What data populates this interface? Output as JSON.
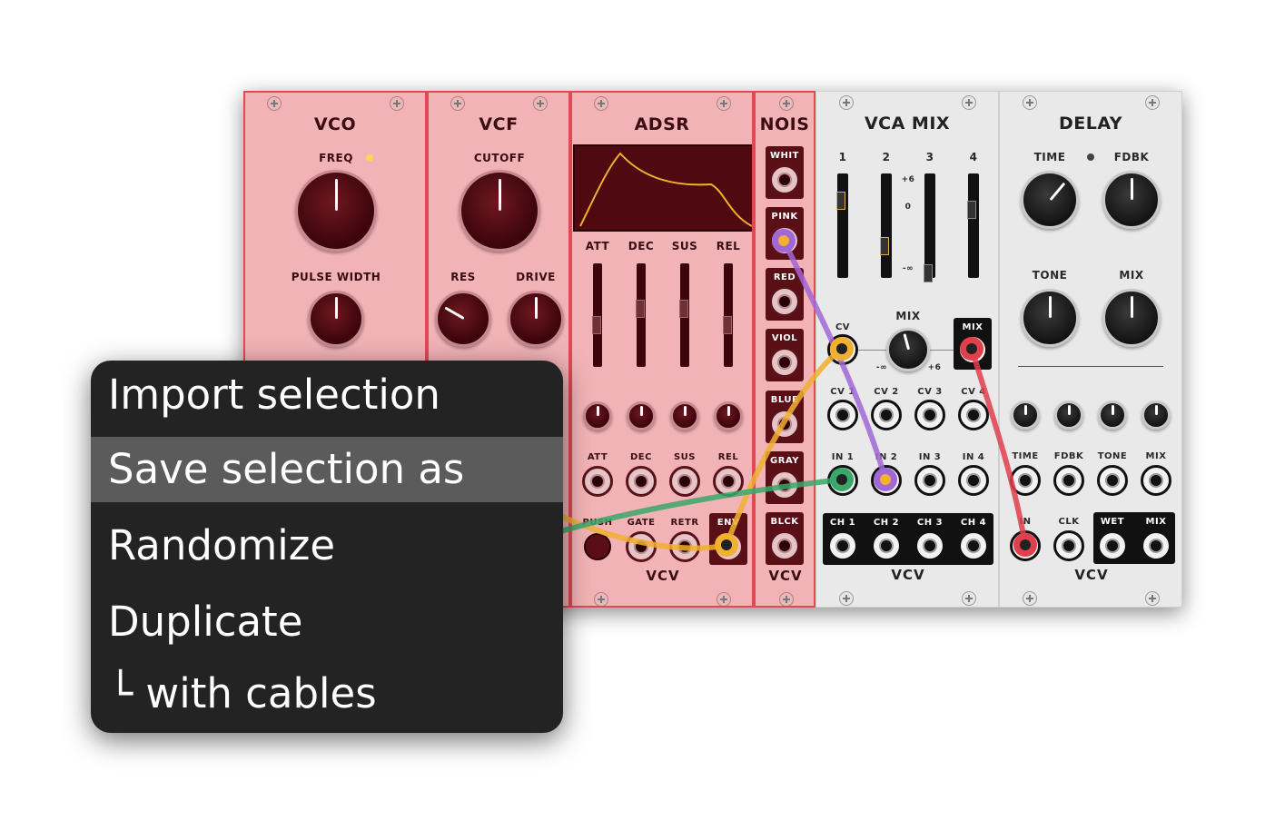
{
  "menu": {
    "items": [
      {
        "label": "Import selection",
        "highlighted": false
      },
      {
        "label": "Save selection as",
        "highlighted": true
      },
      {
        "label": "Randomize",
        "highlighted": false
      },
      {
        "label": "Duplicate",
        "highlighted": false
      },
      {
        "label": "└ with cables",
        "highlighted": false
      }
    ]
  },
  "modules": {
    "vco": {
      "title": "VCO",
      "freq": "FREQ",
      "pulse_width": "PULSE WIDTH"
    },
    "vcf": {
      "title": "VCF",
      "cutoff": "CUTOFF",
      "res": "RES",
      "drive": "DRIVE"
    },
    "adsr": {
      "title": "ADSR",
      "sliders": [
        "ATT",
        "DEC",
        "SUS",
        "REL"
      ],
      "cv": [
        "ATT",
        "DEC",
        "SUS",
        "REL"
      ],
      "push": "PUSH",
      "gate": "GATE",
      "retr": "RETR",
      "env": "ENV",
      "logo": "VCV"
    },
    "noise": {
      "title": "NOIS",
      "outputs": [
        "WHIT",
        "PINK",
        "RED",
        "VIOL",
        "BLUE",
        "GRAY",
        "BLCK"
      ],
      "logo": "VCV"
    },
    "vcamix": {
      "title": "VCA MIX",
      "channels": [
        "1",
        "2",
        "3",
        "4"
      ],
      "scale_top": "+6",
      "scale_mid": "0",
      "scale_bot": "-∞",
      "mix": "MIX",
      "cv": "CV",
      "mix_min": "-∞",
      "mix_max": "+6",
      "mix_out": "MIX",
      "cvs": [
        "CV 1",
        "CV 2",
        "CV 3",
        "CV 4"
      ],
      "ins": [
        "IN 1",
        "IN 2",
        "IN 3",
        "IN 4"
      ],
      "chs": [
        "CH 1",
        "CH 2",
        "CH 3",
        "CH 4"
      ],
      "logo": "VCV"
    },
    "delay": {
      "title": "DELAY",
      "time": "TIME",
      "fdbk": "FDBK",
      "tone": "TONE",
      "mix": "MIX",
      "cv": [
        "TIME",
        "FDBK",
        "TONE",
        "MIX"
      ],
      "in": "IN",
      "clk": "CLK",
      "wet": "WET",
      "mixout": "MIX",
      "logo": "VCV"
    }
  },
  "colors": {
    "selection_fill": "#f1b3b6",
    "selection_border": "#df4a55",
    "menu_bg": "#232323",
    "menu_highlight": "#5b5b5b",
    "cable_orange": "#f2b030",
    "cable_green": "#3aa86a",
    "cable_purple": "#a267d6",
    "cable_red": "#e0404c"
  }
}
